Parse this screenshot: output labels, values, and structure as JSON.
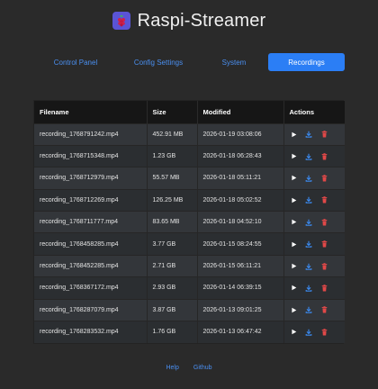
{
  "app": {
    "title": "Raspi-Streamer",
    "logo_icon": "raspberry-logo-icon"
  },
  "nav": {
    "tabs": [
      {
        "label": "Control Panel",
        "active": false
      },
      {
        "label": "Config Settings",
        "active": false
      },
      {
        "label": "System",
        "active": false
      },
      {
        "label": "Recordings",
        "active": true
      }
    ]
  },
  "table": {
    "headers": [
      "Filename",
      "Size",
      "Modified",
      "Actions"
    ],
    "rows": [
      {
        "filename": "recording_1768791242.mp4",
        "size": "452.91 MB",
        "modified": "2026-01-19 03:08:06"
      },
      {
        "filename": "recording_1768715348.mp4",
        "size": "1.23 GB",
        "modified": "2026-01-18 06:28:43"
      },
      {
        "filename": "recording_1768712979.mp4",
        "size": "55.57 MB",
        "modified": "2026-01-18 05:11:21"
      },
      {
        "filename": "recording_1768712269.mp4",
        "size": "126.25 MB",
        "modified": "2026-01-18 05:02:52"
      },
      {
        "filename": "recording_1768711777.mp4",
        "size": "83.65 MB",
        "modified": "2026-01-18 04:52:10"
      },
      {
        "filename": "recording_1768458285.mp4",
        "size": "3.77 GB",
        "modified": "2026-01-15 08:24:55"
      },
      {
        "filename": "recording_1768452285.mp4",
        "size": "2.71 GB",
        "modified": "2026-01-15 06:11:21"
      },
      {
        "filename": "recording_1768367172.mp4",
        "size": "2.93 GB",
        "modified": "2026-01-14 06:39:15"
      },
      {
        "filename": "recording_1768287079.mp4",
        "size": "3.87 GB",
        "modified": "2026-01-13 09:01:25"
      },
      {
        "filename": "recording_1768283532.mp4",
        "size": "1.76 GB",
        "modified": "2026-01-13 06:47:42"
      }
    ],
    "action_icons": [
      "play-icon",
      "download-icon",
      "trash-icon"
    ]
  },
  "footer": {
    "links": [
      "Help",
      "Github"
    ]
  },
  "colors": {
    "accent": "#2b7ef5",
    "link": "#4a8ff0",
    "delete": "#e04848",
    "background": "#2a2a2a"
  }
}
